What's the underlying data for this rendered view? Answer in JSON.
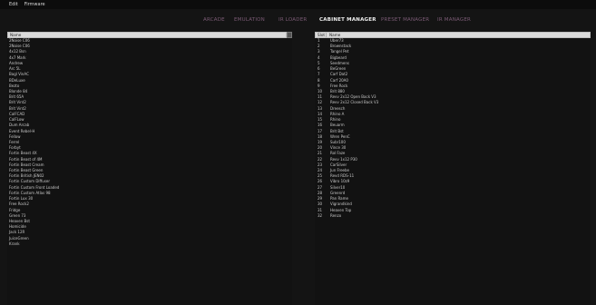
{
  "menubar": {
    "items": [
      "Edit",
      "Firmware"
    ]
  },
  "nav": {
    "tabs": [
      {
        "label": "ARCADE",
        "active": false
      },
      {
        "label": "EMULATION",
        "active": false
      },
      {
        "label": "IR LOADER",
        "active": false
      },
      {
        "label": "CABINET MANAGER",
        "active": true
      },
      {
        "label": "PRESET MANAGER",
        "active": false
      },
      {
        "label": "IR MANAGER",
        "active": false
      }
    ]
  },
  "left_panel": {
    "header": "Name",
    "rows": [
      "2Noise C06",
      "2Noise C06",
      "4x12 Bsn",
      "4x7 Mark",
      "Andrew",
      "Arc 5L",
      "Bagl VinAC",
      "BDeLuxe",
      "Bezto",
      "Blonde 84",
      "Brit 65A",
      "Brit Vint2",
      "Brit Vint2",
      "CalFCAD",
      "CalFLow",
      "Dum Arcab",
      "Event Rebel-H",
      "Fellow",
      "Ferrel",
      "Forbyt",
      "Fortin Beast 4X",
      "Fortin Beast of 4M",
      "Fortin Beast Cream",
      "Fortin Beast Green",
      "Fortin British JEN02",
      "Fortin Custom Diffuser",
      "Fortin Custom Front Loaded",
      "Fortin Custom Atlas 98",
      "Fortin Lux 30",
      "Free Rock2",
      "Fridge",
      "Green 73",
      "Heaven Bst",
      "Homicide",
      "Jack 12R",
      "JuiceGreen",
      "Krank"
    ]
  },
  "right_panel": {
    "header_slot": "Slot",
    "header_name": "Name",
    "rows": [
      {
        "slot": "1",
        "name": "Uber73"
      },
      {
        "slot": "2",
        "name": "Brownstack"
      },
      {
        "slot": "3",
        "name": "Tangel Pet"
      },
      {
        "slot": "4",
        "name": "Bigbeard"
      },
      {
        "slot": "5",
        "name": "Seedmens"
      },
      {
        "slot": "6",
        "name": "BeGreen"
      },
      {
        "slot": "7",
        "name": "Carf Dat2"
      },
      {
        "slot": "8",
        "name": "Carf 20A0"
      },
      {
        "slot": "9",
        "name": "Free Rock"
      },
      {
        "slot": "10",
        "name": "Brit 880"
      },
      {
        "slot": "11",
        "name": "Revv 2x12 Open Back V3"
      },
      {
        "slot": "12",
        "name": "Revv 2x12 Closed Back V3"
      },
      {
        "slot": "13",
        "name": "Dreesch"
      },
      {
        "slot": "14",
        "name": "Rhino A"
      },
      {
        "slot": "15",
        "name": "Rhino"
      },
      {
        "slot": "16",
        "name": "Beuarm"
      },
      {
        "slot": "17",
        "name": "Brit Bst"
      },
      {
        "slot": "18",
        "name": "Wren PenC"
      },
      {
        "slot": "19",
        "name": "Subr100"
      },
      {
        "slot": "20",
        "name": "Vince 30"
      },
      {
        "slot": "21",
        "name": "Rol Faze"
      },
      {
        "slot": "22",
        "name": "Revv 1x12 P30"
      },
      {
        "slot": "23",
        "name": "CarSilver"
      },
      {
        "slot": "24",
        "name": "Jun Freebe"
      },
      {
        "slot": "25",
        "name": "Revd RDS-11"
      },
      {
        "slot": "26",
        "name": "Vibro 10z9"
      },
      {
        "slot": "27",
        "name": "Silver10"
      },
      {
        "slot": "28",
        "name": "Greenrd"
      },
      {
        "slot": "29",
        "name": "Pan Rame"
      },
      {
        "slot": "30",
        "name": "Vigrandkind"
      },
      {
        "slot": "31",
        "name": "Heaven Top"
      },
      {
        "slot": "32",
        "name": "Renzo"
      }
    ]
  }
}
